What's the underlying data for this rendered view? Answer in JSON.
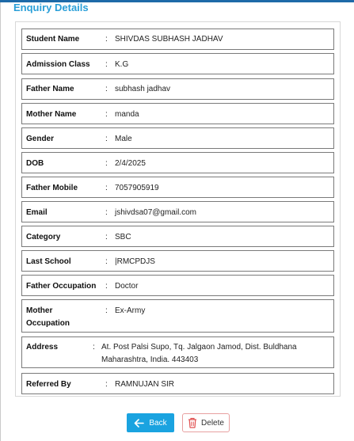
{
  "page": {
    "title": "Enquiry Details"
  },
  "fields": [
    {
      "label": "Student Name",
      "value": "SHIVDAS SUBHASH JADHAV"
    },
    {
      "label": "Admission Class",
      "value": "K.G"
    },
    {
      "label": "Father Name",
      "value": "subhash jadhav"
    },
    {
      "label": "Mother Name",
      "value": "manda"
    },
    {
      "label": "Gender",
      "value": "Male"
    },
    {
      "label": "DOB",
      "value": "2/4/2025"
    },
    {
      "label": "Father Mobile",
      "value": "7057905919"
    },
    {
      "label": "Email",
      "value": "jshivdsa07@gmail.com"
    },
    {
      "label": "Category",
      "value": "SBC"
    },
    {
      "label": "Last School",
      "value": "|RMCPDJS"
    },
    {
      "label": "Father Occupation",
      "value": "Doctor"
    },
    {
      "label": "Mother Occupation",
      "value": "Ex-Army"
    },
    {
      "label": "Address",
      "value": "At. Post Palsi Supo, Tq. Jalgaon Jamod, Dist. Buldhana Maharashtra, India. 443403"
    },
    {
      "label": "Referred By",
      "value": "RAMNUJAN SIR"
    }
  ],
  "separator": ":",
  "buttons": {
    "back_label": "Back",
    "delete_label": "Delete"
  },
  "icons": {
    "back": "arrow-left-icon",
    "delete": "trash-icon"
  },
  "colors": {
    "accent": "#2a9fd8",
    "back_button": "#1aa3e0",
    "delete_icon": "#e05050"
  }
}
